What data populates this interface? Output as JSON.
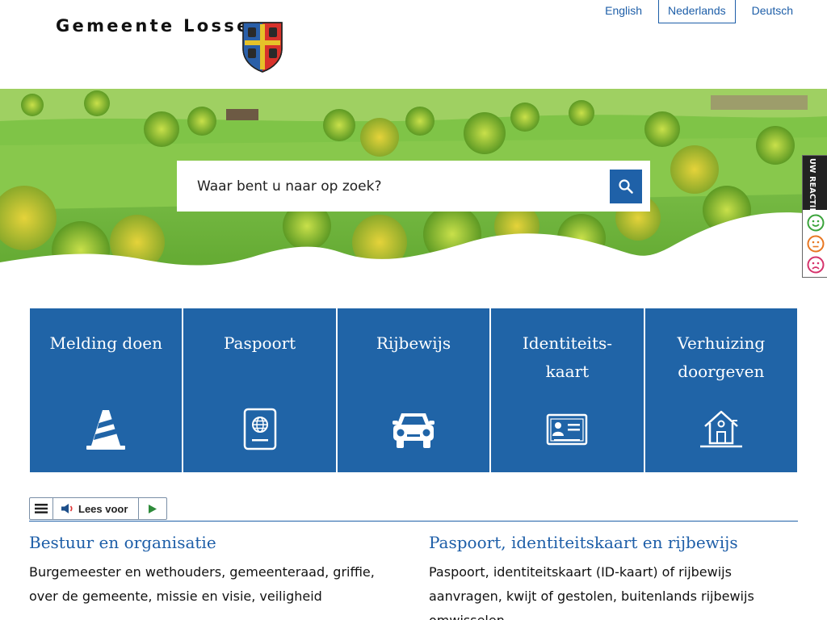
{
  "header": {
    "site_name": "Gemeente Losser",
    "languages": [
      {
        "label": "English",
        "active": false
      },
      {
        "label": "Nederlands",
        "active": true
      },
      {
        "label": "Deutsch",
        "active": false
      }
    ]
  },
  "search": {
    "placeholder": "Waar bent u naar op zoek?",
    "button_icon": "search-icon"
  },
  "feedback": {
    "label": "UW REACTIE",
    "options": [
      "happy-smiley-icon",
      "neutral-smiley-icon",
      "sad-smiley-icon"
    ],
    "colors": {
      "happy": "#3aa33a",
      "neutral": "#e87722",
      "sad": "#d6336c"
    }
  },
  "tiles": [
    {
      "label": "Melding doen",
      "icon": "traffic-cone-icon"
    },
    {
      "label": "Paspoort",
      "icon": "passport-icon"
    },
    {
      "label": "Rijbewijs",
      "icon": "car-icon"
    },
    {
      "label": "Identiteits-\nkaart",
      "icon": "id-card-icon"
    },
    {
      "label": "Verhuizing\ndoorgeven",
      "icon": "house-icon"
    }
  ],
  "readspeaker": {
    "menu_icon": "menu-icon",
    "label": "Lees voor",
    "speaker_icon": "speaker-icon",
    "play_icon": "play-icon"
  },
  "sections": [
    {
      "title": "Bestuur en organisatie",
      "description": "Burgemeester en wethouders, gemeenteraad, griffie, over de gemeente, missie en visie, veiligheid"
    },
    {
      "title": "Paspoort, identiteitskaart en rijbewijs",
      "description": "Paspoort, identiteitskaart (ID-kaart) of rijbewijs aanvragen, kwijt of gestolen, buitenlands rijbewijs omwisselen"
    }
  ],
  "colors": {
    "primary": "#2064a7",
    "link": "#1d5ea8"
  }
}
